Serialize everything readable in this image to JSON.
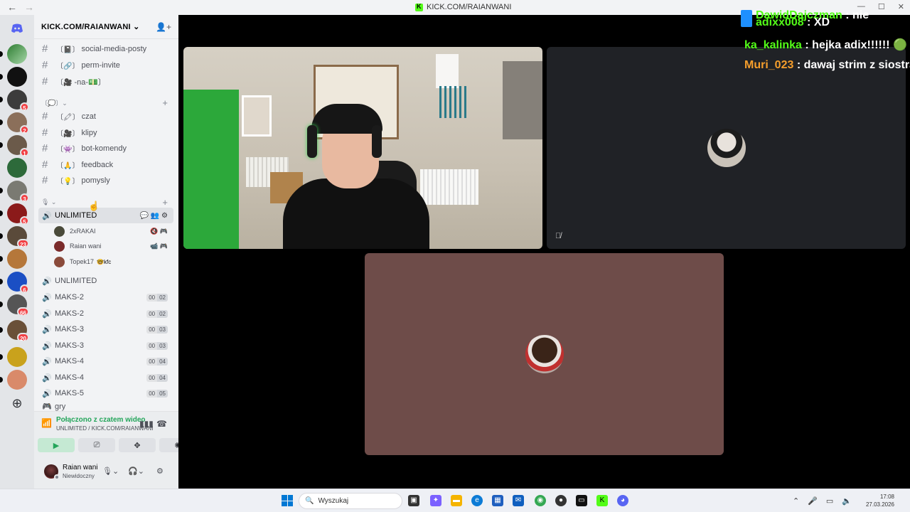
{
  "titlebar": {
    "back": "←",
    "forward": "→",
    "title": "KICK.COM/RAIANWANI",
    "win_min": "—",
    "win_max": "☐",
    "win_close": "✕"
  },
  "servers": [
    {
      "badge": ""
    },
    {
      "badge": ""
    },
    {
      "badge": "5"
    },
    {
      "badge": "2"
    },
    {
      "badge": "1"
    },
    {
      "badge": ""
    },
    {
      "badge": "3"
    },
    {
      "badge": "5"
    },
    {
      "badge": "23"
    },
    {
      "badge": ""
    },
    {
      "badge": "6"
    },
    {
      "badge": "66"
    },
    {
      "badge": "20"
    },
    {
      "badge": ""
    },
    {
      "badge": ""
    }
  ],
  "sidebar": {
    "server_name": "KICK.COM/RAIANWANI",
    "chevron": "⌄",
    "channels_top": [
      {
        "hash": "#",
        "emoji": "〔📓〕",
        "name": "social-media-posty"
      },
      {
        "hash": "#",
        "emoji": "〔🔗〕",
        "name": "perm-invite"
      },
      {
        "hash": "#",
        "emoji": "〔🎥",
        "name": "-na-💵〕"
      }
    ],
    "category1": "〔💭〕⌄",
    "channels_mid": [
      {
        "hash": "#",
        "emoji": "〔🖍〕",
        "name": "czat"
      },
      {
        "hash": "#",
        "emoji": "〔🎥〕",
        "name": "klipy"
      },
      {
        "hash": "#",
        "emoji": "〔👾〕",
        "name": "bot-komendy"
      },
      {
        "hash": "#",
        "emoji": "〔🙏〕",
        "name": "feedback"
      },
      {
        "hash": "#",
        "emoji": "〔💡〕",
        "name": "pomysly"
      }
    ],
    "category2": "🎙 ⌄",
    "plus": "+",
    "active_voice": {
      "name": "UNLIMITED",
      "icons": "💬 👥 ⚙"
    },
    "members": [
      {
        "name": "2xRAKAI",
        "icons": "🔇 🎮",
        "tag": ""
      },
      {
        "name": "Raian wani",
        "icons": "📹 🎮",
        "tag": ""
      },
      {
        "name": "Topek17",
        "icons": "",
        "tag": "🤓kfc"
      }
    ],
    "voice_channels": [
      {
        "name": "UNLIMITED",
        "c1": "",
        "c2": ""
      },
      {
        "name": "MAKS-2",
        "c1": "00",
        "c2": "02"
      },
      {
        "name": "MAKS-2",
        "c1": "00",
        "c2": "02"
      },
      {
        "name": "MAKS-3",
        "c1": "00",
        "c2": "03"
      },
      {
        "name": "MAKS-3",
        "c1": "00",
        "c2": "03"
      },
      {
        "name": "MAKS-4",
        "c1": "00",
        "c2": "04"
      },
      {
        "name": "MAKS-4",
        "c1": "00",
        "c2": "04"
      },
      {
        "name": "MAKS-5",
        "c1": "00",
        "c2": "05"
      }
    ],
    "partial_channel": "gry"
  },
  "voice_panel": {
    "status": "Połączono z czatem wideo",
    "location": "UNLIMITED / KICK.COM/RAIANWANI"
  },
  "user_panel": {
    "name": "Raian wani",
    "status": "Niewidoczny"
  },
  "chat_overlay": [
    {
      "user": "DawidDajczman",
      "msg": " : nie",
      "color": "green"
    },
    {
      "user": "adixx008",
      "msg": " : XD",
      "color": "green"
    },
    {
      "user": "ka_kalinka",
      "msg": " : hejka adix!!!!!! 🟢",
      "color": "green"
    },
    {
      "user": "Muri_023",
      "msg": " : dawaj strim z siostrą",
      "color": "orange"
    }
  ],
  "taskbar": {
    "search_placeholder": "Wyszukaj",
    "time": "17:08",
    "date": "27.03.2026",
    "tray_up": "⌃"
  },
  "colors": {
    "accent_green": "#23a55a",
    "kick_green": "#53fc18",
    "sidebar_bg": "#f2f3f5",
    "tile3_bg": "#6e4c49"
  }
}
